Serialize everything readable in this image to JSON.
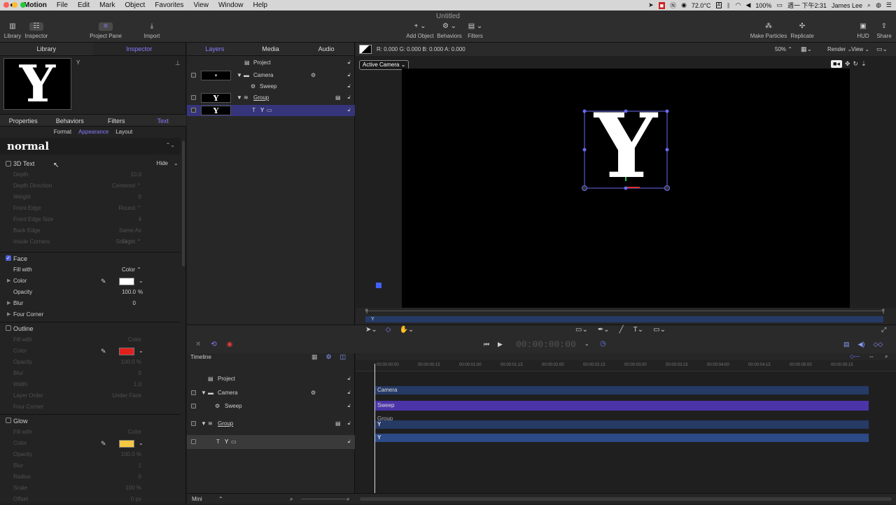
{
  "menubar": {
    "apple": "",
    "app": "Motion",
    "items": [
      "File",
      "Edit",
      "Mark",
      "Object",
      "Favorites",
      "View",
      "Window",
      "Help"
    ],
    "status": {
      "temp": "72.0°C",
      "battery": "100%",
      "clock": "週一 下午2:31",
      "user": "James Lee"
    }
  },
  "toolbar": {
    "title": "Untitled",
    "library": "Library",
    "inspector": "Inspector",
    "project_pane": "Project Pane",
    "import": "Import",
    "add_object": "Add Object",
    "behaviors": "Behaviors",
    "filters": "Filters",
    "make_particles": "Make Particles",
    "replicate": "Replicate",
    "hud": "HUD",
    "share": "Share"
  },
  "left": {
    "tabs": [
      "Library",
      "Inspector"
    ],
    "preview_letter": "Y",
    "preview_name": "Y",
    "subtabs": [
      "Properties",
      "Behaviors",
      "Filters",
      "Text"
    ],
    "text_tabs": [
      "Format",
      "Appearance",
      "Layout"
    ],
    "style_name": "normal",
    "text3d": {
      "label": "3D Text",
      "hide": "Hide"
    },
    "text3d_rows": [
      {
        "label": "Depth",
        "value": "10.0"
      },
      {
        "label": "Depth Direction",
        "value": "Centered ⌃"
      },
      {
        "label": "Weight",
        "value": "0"
      },
      {
        "label": "Front Edge",
        "value": "Round ⌃"
      },
      {
        "label": "Front Edge Size",
        "value": "4"
      },
      {
        "label": "Back Edge",
        "value": "Same As Front ⌃"
      },
      {
        "label": "Inside Corners",
        "value": "Straight ⌃"
      }
    ],
    "face": {
      "label": "Face",
      "fill_with": "Fill with",
      "fill_value": "Color",
      "color": "Color",
      "opacity": "Opacity",
      "opacity_value": "100.0",
      "pct": "%",
      "blur": "Blur",
      "blur_value": "0",
      "four_corner": "Four Corner"
    },
    "outline": {
      "label": "Outline",
      "rows": [
        {
          "label": "Fill with",
          "value": "Color"
        },
        {
          "label": "Color",
          "value": ""
        },
        {
          "label": "Opacity",
          "value": "100.0 %"
        },
        {
          "label": "Blur",
          "value": "0"
        },
        {
          "label": "Width",
          "value": "1.0"
        },
        {
          "label": "Layer Order",
          "value": "Under Face"
        },
        {
          "label": "Four Corner",
          "value": ""
        }
      ]
    },
    "glow": {
      "label": "Glow",
      "rows": [
        {
          "label": "Fill with",
          "value": "Color"
        },
        {
          "label": "Color",
          "value": ""
        },
        {
          "label": "Opacity",
          "value": "100.0 %"
        },
        {
          "label": "Blur",
          "value": "1"
        },
        {
          "label": "Radius",
          "value": "0"
        },
        {
          "label": "Scale",
          "value": "100 %"
        },
        {
          "label": "Offset",
          "value": "0 px"
        }
      ]
    },
    "colors": {
      "face": "#ffffff",
      "outline": "#e0201b",
      "glow": "#f5c842"
    }
  },
  "layers": {
    "tabs": [
      "Layers",
      "Media",
      "Audio"
    ],
    "items": [
      {
        "name": "Project"
      },
      {
        "name": "Camera"
      },
      {
        "name": "Sweep"
      },
      {
        "name": "Group"
      },
      {
        "name": "Y"
      }
    ]
  },
  "canvas": {
    "readout": "R: 0.000  G: 0.000  B: 0.000  A: 0.000",
    "zoom": "50%",
    "render": "Render",
    "view": "View",
    "camera_menu": "Active Camera",
    "glyph": "Y"
  },
  "minitimeline": {
    "label": "Y"
  },
  "transport": {
    "timecode": "00:00:00:00"
  },
  "timeline": {
    "label": "Timeline",
    "rows": [
      {
        "name": "Project"
      },
      {
        "name": "Camera"
      },
      {
        "name": "Sweep"
      },
      {
        "name": "Group"
      },
      {
        "name": "Y"
      }
    ],
    "ruler": [
      "00:00:00:00",
      "00:00:00:15",
      "00:00:01:00",
      "00:00:01:15",
      "00:00:02:00",
      "00:00:02:15",
      "00:00:03:00",
      "00:00:03:15",
      "00:00:04:00",
      "00:00:04:15",
      "00:00:05:00",
      "00:00:05:15"
    ],
    "bars": [
      {
        "label": "Camera",
        "color": "#263a66"
      },
      {
        "label": "Sweep",
        "color": "#4a34a8"
      },
      {
        "label": "Group",
        "color": "#263a66"
      },
      {
        "label": "Y",
        "color": "#263a66"
      },
      {
        "label": "Y",
        "color": "#2c4a86"
      }
    ]
  },
  "status": {
    "mini": "Mini"
  }
}
